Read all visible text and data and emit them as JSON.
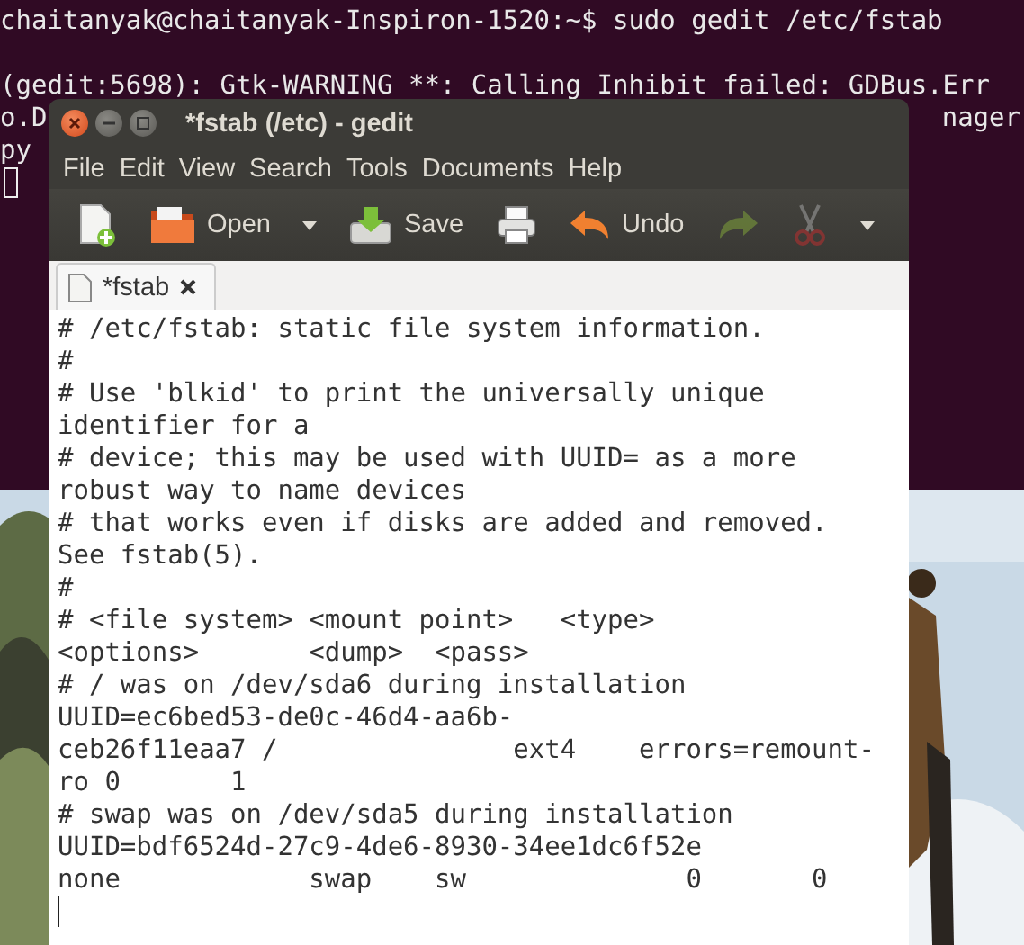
{
  "terminal": {
    "lines": [
      {
        "kind": "full",
        "text": "chaitanyak@chaitanyak-Inspiron-1520:~$ sudo gedit /etc/fstab"
      },
      {
        "kind": "blank"
      },
      {
        "kind": "full",
        "text": "(gedit:5698): Gtk-WARNING **: Calling Inhibit failed: GDBus.Err"
      },
      {
        "kind": "split",
        "left": "o.D",
        "right": "nager"
      },
      {
        "kind": "full",
        "text": "py"
      },
      {
        "kind": "cursor"
      }
    ]
  },
  "window": {
    "title": "*fstab (/etc) - gedit",
    "menu": [
      "File",
      "Edit",
      "View",
      "Search",
      "Tools",
      "Documents",
      "Help"
    ],
    "toolbar": [
      {
        "kind": "new",
        "disabled": false
      },
      {
        "kind": "open",
        "label": "Open",
        "disabled": false
      },
      {
        "kind": "caret",
        "disabled": false
      },
      {
        "kind": "save",
        "label": "Save",
        "disabled": false
      },
      {
        "kind": "print",
        "disabled": false
      },
      {
        "kind": "undo",
        "label": "Undo",
        "disabled": false
      },
      {
        "kind": "redo",
        "disabled": true
      },
      {
        "kind": "cut",
        "disabled": true
      },
      {
        "kind": "caret",
        "disabled": false
      }
    ],
    "tabs": [
      {
        "label": "*fstab",
        "selected": true
      }
    ],
    "editor": {
      "lines": [
        "# /etc/fstab: static file system information.",
        "#",
        "# Use 'blkid' to print the universally unique",
        "identifier for a",
        "# device; this may be used with UUID= as a more",
        "robust way to name devices",
        "# that works even if disks are added and removed.",
        "See fstab(5).",
        "#",
        "# <file system> <mount point>   <type>",
        "<options>       <dump>  <pass>",
        "# / was on /dev/sda6 during installation",
        "UUID=ec6bed53-de0c-46d4-aa6b-",
        "ceb26f11eaa7 /               ext4    errors=remount-",
        "ro 0       1",
        "# swap was on /dev/sda5 during installation",
        "UUID=bdf6524d-27c9-4de6-8930-34ee1dc6f52e",
        "none            swap    sw              0       0"
      ]
    }
  }
}
